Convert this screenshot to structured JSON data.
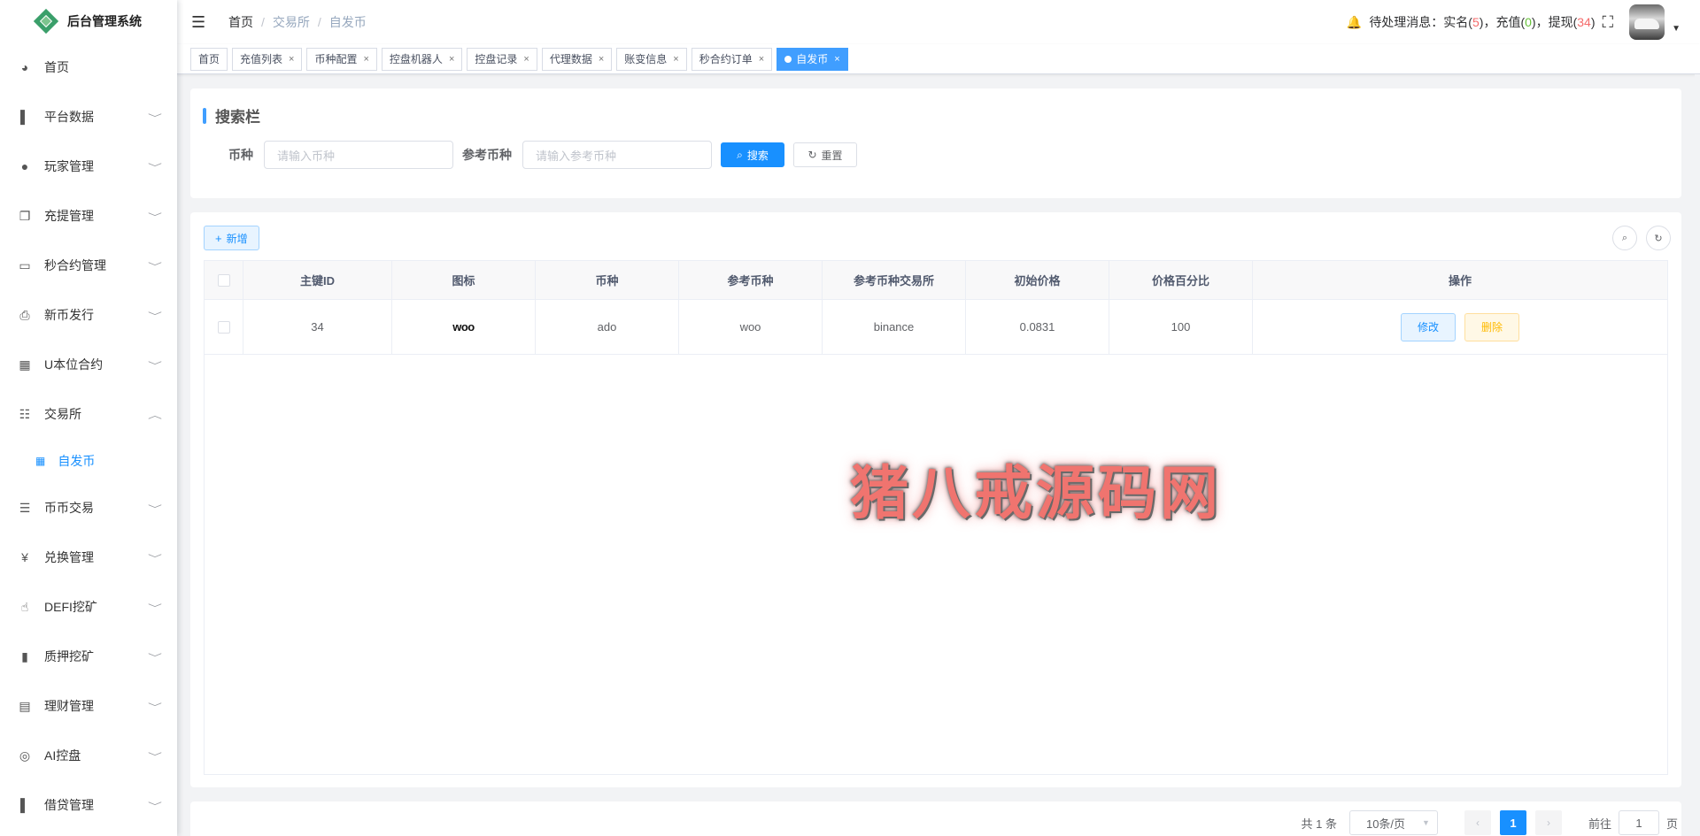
{
  "app": {
    "title": "后台管理系统"
  },
  "sidebar": {
    "items": [
      {
        "label": "首页",
        "icon": "dashboard-icon",
        "glyph": "◕",
        "chevron": false
      },
      {
        "label": "平台数据",
        "icon": "book-icon",
        "glyph": "▌",
        "chevron": true
      },
      {
        "label": "玩家管理",
        "icon": "user-icon",
        "glyph": "●",
        "chevron": true
      },
      {
        "label": "充提管理",
        "icon": "copy-icon",
        "glyph": "❐",
        "chevron": true
      },
      {
        "label": "秒合约管理",
        "icon": "monitor-icon",
        "glyph": "▭",
        "chevron": true
      },
      {
        "label": "新币发行",
        "icon": "printer-icon",
        "glyph": "⎙",
        "chevron": true
      },
      {
        "label": "U本位合约",
        "icon": "grid-icon",
        "glyph": "▦",
        "chevron": true
      },
      {
        "label": "交易所",
        "icon": "list-tree-icon",
        "glyph": "☷",
        "chevron": true,
        "expanded": true
      },
      {
        "label": "币币交易",
        "icon": "list-icon",
        "glyph": "☰",
        "chevron": true
      },
      {
        "label": "兑换管理",
        "icon": "yen-icon",
        "glyph": "¥",
        "chevron": true
      },
      {
        "label": "DEFI挖矿",
        "icon": "hand-icon",
        "glyph": "☝",
        "chevron": true
      },
      {
        "label": "质押挖矿",
        "icon": "bar-chart-icon",
        "glyph": "▮",
        "chevron": true
      },
      {
        "label": "理财管理",
        "icon": "document-icon",
        "glyph": "▤",
        "chevron": true
      },
      {
        "label": "AI控盘",
        "icon": "robot-icon",
        "glyph": "◎",
        "chevron": true
      },
      {
        "label": "借贷管理",
        "icon": "ledger-icon",
        "glyph": "▌",
        "chevron": true
      }
    ],
    "submenu": {
      "label": "自发币",
      "icon": "table-icon",
      "glyph": "▦"
    }
  },
  "navbar": {
    "breadcrumb": [
      "首页",
      "交易所",
      "自发币"
    ],
    "notice": {
      "prefix": "待处理消息：实名(",
      "realname_count": "5",
      "recharge_prefix": ")，充值(",
      "recharge_count": "0",
      "withdraw_prefix": ")，提现(",
      "withdraw_count": "34",
      "suffix": ")"
    },
    "colors": {
      "alert": "#f56c6c",
      "ok": "#67c23a"
    }
  },
  "tags": [
    {
      "label": "首页",
      "closable": false,
      "active": false
    },
    {
      "label": "充值列表",
      "closable": true,
      "active": false
    },
    {
      "label": "币种配置",
      "closable": true,
      "active": false
    },
    {
      "label": "控盘机器人",
      "closable": true,
      "active": false
    },
    {
      "label": "控盘记录",
      "closable": true,
      "active": false
    },
    {
      "label": "代理数据",
      "closable": true,
      "active": false
    },
    {
      "label": "账变信息",
      "closable": true,
      "active": false
    },
    {
      "label": "秒合约订单",
      "closable": true,
      "active": false
    },
    {
      "label": "自发币",
      "closable": true,
      "active": true
    }
  ],
  "search": {
    "title": "搜索栏",
    "coin_label": "币种",
    "coin_placeholder": "请输入币种",
    "ref_label": "参考币种",
    "ref_placeholder": "请输入参考币种",
    "search_btn": "搜索",
    "reset_btn": "重置"
  },
  "toolbar": {
    "add_btn": "新增"
  },
  "table": {
    "columns": [
      "主键ID",
      "图标",
      "币种",
      "参考币种",
      "参考币种交易所",
      "初始价格",
      "价格百分比",
      "操作"
    ],
    "rows": [
      {
        "id": "34",
        "icon_text": "woo",
        "coin": "ado",
        "ref_coin": "woo",
        "exchange": "binance",
        "init_price": "0.0831",
        "percent": "100"
      }
    ],
    "edit_btn": "修改",
    "delete_btn": "删除"
  },
  "watermark": "猪八戒源码网",
  "pagination": {
    "total_text": "共 1 条",
    "page_size": "10条/页",
    "current_page": "1",
    "goto_label": "前往",
    "goto_value": "1",
    "page_unit": "页"
  },
  "theme": {
    "primary": "#1890ff",
    "danger": "#ffba00"
  }
}
